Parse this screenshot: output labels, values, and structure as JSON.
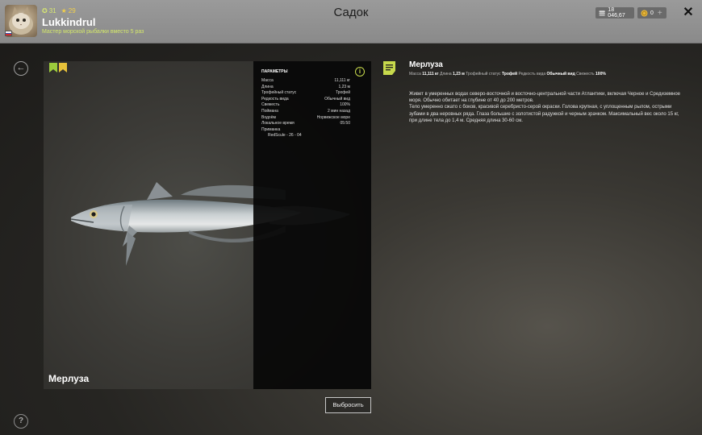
{
  "header": {
    "title": "Садок",
    "username": "Lukkindrul",
    "player_subtitle": "Мастер морской рыбалки вместо 5 раз",
    "stat_level": "31",
    "stat_stars": "29",
    "silver": "18 046,67",
    "gold": "0",
    "add_label": "+",
    "close_label": "✕"
  },
  "fish": {
    "name": "Мерлуза",
    "params_title": "ПАРАМЕТРЫ",
    "params": [
      {
        "label": "Масса",
        "value": "11,111 кг"
      },
      {
        "label": "Длина",
        "value": "1,23 м"
      },
      {
        "label": "Трофейный статус",
        "value": "Трофей"
      },
      {
        "label": "Редкость вида",
        "value": "Обычный вид"
      },
      {
        "label": "Свежесть",
        "value": "100%"
      },
      {
        "label": "Поймана",
        "value": "2 мин назад"
      },
      {
        "label": "Водоём",
        "value": "Норвежское море"
      },
      {
        "label": "Локальное время",
        "value": "05:50"
      }
    ],
    "bait_label": "Приманка",
    "bait_value": "RedScule - 26 - 04"
  },
  "actions": {
    "discard": "Выбросить",
    "back": "←",
    "help": "?",
    "info": "i"
  },
  "description": {
    "title": "Мерлуза",
    "meta": [
      {
        "label": "Масса",
        "value": "11,111 кг"
      },
      {
        "label": "Длина",
        "value": "1,23 м"
      },
      {
        "label": "Трофейный статус",
        "value": "Трофей"
      },
      {
        "label": "Редкость вида",
        "value": "Обычный вид"
      },
      {
        "label": "Свежесть",
        "value": "100%"
      }
    ],
    "paragraph1": "Живет в умеренных водах северо-восточной и восточно-центральной части Атлантики, включая Черное и Средиземное моря. Обычно обитает на глубине от 40 до 200 метров.",
    "paragraph2": "Тело умеренно сжато с боков, красивой серебристо-серой окраски. Голова крупная, с уплощенным рылом, острыми зубами в два неровных ряда. Глаза большие с золотистой радужкой и черным зрачком. Максимальный вес около 15 кг, при длине тела до 1,4 м. Средняя длина 30-60 см."
  },
  "colors": {
    "accent": "#c7d94c",
    "badge_green": "#9ccc3c",
    "badge_yellow": "#e6c13a"
  },
  "icons": {
    "back": "arrow-left-icon",
    "help": "question-icon",
    "info": "info-icon",
    "description": "document-icon",
    "silver": "coin-stack-icon",
    "gold": "gold-coin-icon",
    "close": "close-icon"
  }
}
